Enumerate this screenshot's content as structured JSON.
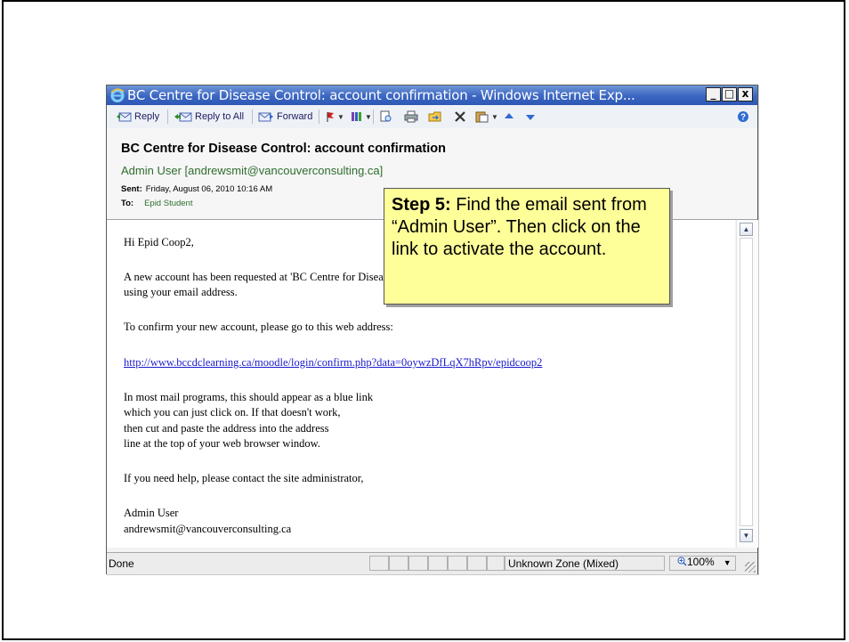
{
  "window": {
    "title": "BC Centre for Disease Control: account confirmation - Windows Internet Exp...",
    "controls": {
      "minimize": "_",
      "maximize": "□",
      "close": "x"
    }
  },
  "toolbar": {
    "reply": "Reply",
    "reply_all": "Reply to All",
    "forward": "Forward",
    "help_icon": "help-icon"
  },
  "message": {
    "subject": "BC Centre for Disease Control: account confirmation",
    "from": "Admin User [andrewsmit@vancouverconsulting.ca]",
    "sent_label": "Sent:",
    "sent_value": "Friday, August 06, 2010 10:16 AM",
    "to_label": "To:",
    "to_value": "Epid Student",
    "body": {
      "greeting": "Hi Epid Coop2,",
      "para1_line1": "A new account has been requested at 'BC Centre for Disease Control'",
      "para1_line2": "using your email address.",
      "para2": "To confirm your new account, please go to this web address:",
      "link": "http://www.bccdclearning.ca/moodle/login/confirm.php?data=0oywzDfLqX7hRpv/epidcoop2",
      "para3_line1": "In most mail programs, this should appear as a blue link",
      "para3_line2": "which you can just click on. If that doesn't work,",
      "para3_line3": "then cut and paste the address into the address",
      "para3_line4": "line at the top of your web browser window.",
      "para4": "If you need help, please contact the site administrator,",
      "sig_name": "Admin User",
      "sig_email": "andrewsmit@vancouverconsulting.ca"
    }
  },
  "statusbar": {
    "status": "Done",
    "zone": "Unknown Zone (Mixed)",
    "zoom": "100%"
  },
  "callout": {
    "step": "Step 5:",
    "text": " Find the email sent from “Admin User”.  Then click on the link to activate the account."
  }
}
